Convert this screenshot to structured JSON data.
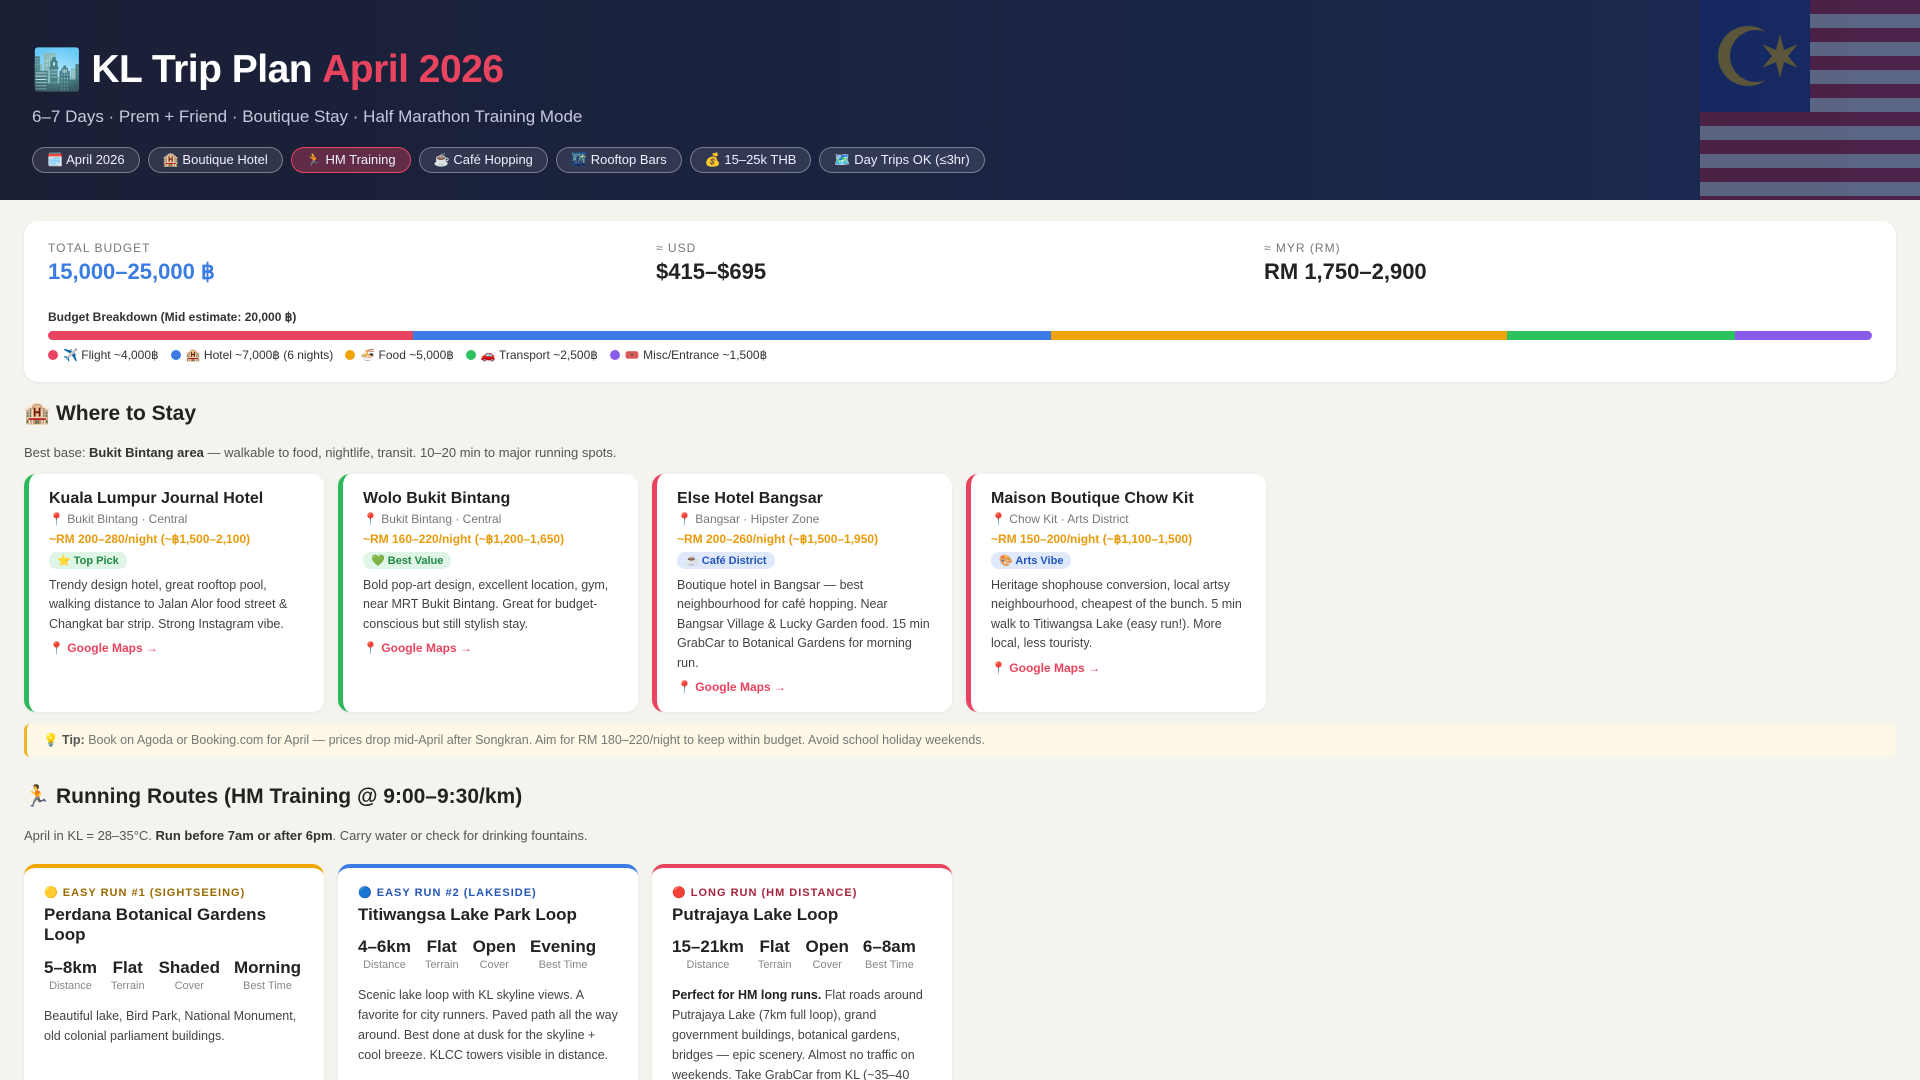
{
  "header": {
    "emoji": "🏙️",
    "title": "KL Trip Plan",
    "title_accent": "April 2026",
    "subtitle": "6–7 Days · Prem + Friend · Boutique Stay · Half Marathon Training Mode",
    "tags": [
      "🗓️ April 2026",
      "🏨 Boutique Hotel",
      "🏃 HM Training",
      "☕ Café Hopping",
      "🌃 Rooftop Bars",
      "💰 15–25k THB",
      "🗺️ Day Trips OK (≤3hr)"
    ]
  },
  "budget": {
    "total_label": "TOTAL BUDGET",
    "total_value": "15,000–25,000 ฿",
    "usd_label": "≈ USD",
    "usd_value": "$415–$695",
    "myr_label": "≈ MYR (RM)",
    "myr_value": "RM 1,750–2,900",
    "breakdown_title": "Budget Breakdown (Mid estimate: 20,000 ฿)",
    "breakdown": [
      {
        "label": "✈️ Flight ~4,000฿",
        "amount": 4000,
        "color": "#e8445f"
      },
      {
        "label": "🏨 Hotel ~7,000฿ (6 nights)",
        "amount": 7000,
        "color": "#3a7be4"
      },
      {
        "label": "🍜 Food ~5,000฿",
        "amount": 5000,
        "color": "#f0a30a"
      },
      {
        "label": "🚗 Transport ~2,500฿",
        "amount": 2500,
        "color": "#2ec25e"
      },
      {
        "label": "🎟️ Misc/Entrance ~1,500฿",
        "amount": 1500,
        "color": "#8a5be8"
      }
    ]
  },
  "stay": {
    "title": "🏨 Where to Stay",
    "desc_prefix": "Best base: ",
    "desc_bold": "Bukit Bintang area",
    "desc_suffix": " — walkable to food, nightlife, transit. 10–20 min to major running spots.",
    "hotels": [
      {
        "name": "Kuala Lumpur Journal Hotel",
        "location": "📍 Bukit Bintang · Central",
        "price": "~RM 200–280/night (~฿1,500–2,100)",
        "badge": "⭐ Top Pick",
        "badge_bg": "#dff5e5",
        "badge_fg": "#1f8a43",
        "accent": "#2eb85c",
        "desc": "Trendy design hotel, great rooftop pool, walking distance to Jalan Alor food street & Changkat bar strip. Strong Instagram vibe.",
        "link": "📍 Google Maps →"
      },
      {
        "name": "Wolo Bukit Bintang",
        "location": "📍 Bukit Bintang · Central",
        "price": "~RM 160–220/night (~฿1,200–1,650)",
        "badge": "💚 Best Value",
        "badge_bg": "#dff5e5",
        "badge_fg": "#1f8a43",
        "accent": "#2eb85c",
        "desc": "Bold pop-art design, excellent location, gym, near MRT Bukit Bintang. Great for budget-conscious but still stylish stay.",
        "link": "📍 Google Maps →"
      },
      {
        "name": "Else Hotel Bangsar",
        "location": "📍 Bangsar · Hipster Zone",
        "price": "~RM 200–260/night (~฿1,500–1,950)",
        "badge": "☕ Café District",
        "badge_bg": "#dfe9fb",
        "badge_fg": "#2456b8",
        "accent": "#e8445f",
        "desc": "Boutique hotel in Bangsar — best neighbourhood for café hopping. Near Bangsar Village & Lucky Garden food. 15 min GrabCar to Botanical Gardens for morning run.",
        "link": "📍 Google Maps →"
      },
      {
        "name": "Maison Boutique Chow Kit",
        "location": "📍 Chow Kit · Arts District",
        "price": "~RM 150–200/night (~฿1,100–1,500)",
        "badge": "🎨 Arts Vibe",
        "badge_bg": "#dfe9fb",
        "badge_fg": "#2456b8",
        "accent": "#e8445f",
        "desc": "Heritage shophouse conversion, local artsy neighbourhood, cheapest of the bunch. 5 min walk to Titiwangsa Lake (easy run!). More local, less touristy.",
        "link": "📍 Google Maps →"
      }
    ]
  },
  "tip": {
    "label": "💡 Tip:",
    "text": " Book on Agoda or Booking.com for April — prices drop mid-April after Songkran. Aim for RM 180–220/night to keep within budget. Avoid school holiday weekends."
  },
  "running": {
    "title": "🏃 Running Routes (HM Training @ 9:00–9:30/km)",
    "desc_prefix": "April in KL = 28–35°C. ",
    "desc_bold": "Run before 7am or after 6pm",
    "desc_suffix": ". Carry water or check for drinking fountains.",
    "routes": [
      {
        "kind": "🟡 EASY RUN #1 (SIGHTSEEING)",
        "kind_color": "#9a6a00",
        "accent": "#f0a500",
        "name": "Perdana Botanical Gardens Loop",
        "metrics": [
          {
            "v": "5–8km",
            "l": "Distance"
          },
          {
            "v": "Flat",
            "l": "Terrain"
          },
          {
            "v": "Shaded",
            "l": "Cover"
          },
          {
            "v": "Morning",
            "l": "Best Time"
          }
        ],
        "desc_bold": "",
        "desc": "Beautiful lake, Bird Park, National Monument, old colonial parliament buildings."
      },
      {
        "kind": "🔵 EASY RUN #2 (LAKESIDE)",
        "kind_color": "#2456b8",
        "accent": "#3a7be4",
        "name": "Titiwangsa Lake Park Loop",
        "metrics": [
          {
            "v": "4–6km",
            "l": "Distance"
          },
          {
            "v": "Flat",
            "l": "Terrain"
          },
          {
            "v": "Open",
            "l": "Cover"
          },
          {
            "v": "Evening",
            "l": "Best Time"
          }
        ],
        "desc_bold": "",
        "desc": "Scenic lake loop with KL skyline views. A favorite for city runners. Paved path all the way around. Best done at dusk for the skyline + cool breeze. KLCC towers visible in distance."
      },
      {
        "kind": "🔴 LONG RUN (HM DISTANCE)",
        "kind_color": "#a8243c",
        "accent": "#e8445f",
        "name": "Putrajaya Lake Loop",
        "metrics": [
          {
            "v": "15–21km",
            "l": "Distance"
          },
          {
            "v": "Flat",
            "l": "Terrain"
          },
          {
            "v": "Open",
            "l": "Cover"
          },
          {
            "v": "6–8am",
            "l": "Best Time"
          }
        ],
        "desc_bold": "Perfect for HM long runs.",
        "desc": " Flat roads around Putrajaya Lake (7km full loop), grand government buildings, botanical gardens, bridges — epic scenery. Almost no traffic on weekends. Take GrabCar from KL (~35–40"
      }
    ]
  }
}
